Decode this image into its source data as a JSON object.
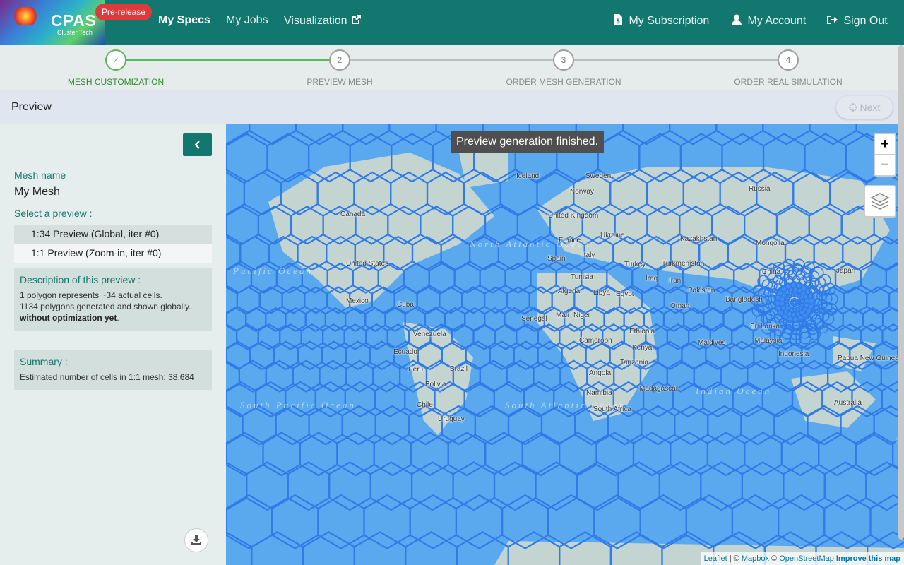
{
  "navbar": {
    "logo_text": "CPAS",
    "logo_subtext": "Cluster Tech",
    "badge": "Pre-release",
    "links": [
      {
        "label": "My Specs",
        "active": true
      },
      {
        "label": "My Jobs",
        "active": false
      },
      {
        "label": "Visualization",
        "icon": "external-link-icon"
      }
    ],
    "right_links": [
      {
        "label": "My Subscription",
        "icon": "dollar-file-icon"
      },
      {
        "label": "My Account",
        "icon": "user-icon"
      },
      {
        "label": "Sign Out",
        "icon": "sign-out-icon"
      }
    ]
  },
  "stepper": {
    "steps": [
      {
        "number": "✓",
        "label": "MESH CUSTOMIZATION",
        "done": true
      },
      {
        "number": "2",
        "label": "PREVIEW MESH",
        "done": false
      },
      {
        "number": "3",
        "label": "ORDER MESH GENERATION",
        "done": false
      },
      {
        "number": "4",
        "label": "ORDER REAL SIMULATION",
        "done": false
      }
    ]
  },
  "header": {
    "title": "Preview",
    "next_label": "Next"
  },
  "sidebar": {
    "mesh_name_label": "Mesh name",
    "mesh_name_value": "My Mesh",
    "select_label": "Select a preview :",
    "options": [
      {
        "label": "1:34 Preview (Global, iter #0)",
        "selected": true
      },
      {
        "label": "1:1 Preview (Zoom-in, iter #0)",
        "selected": false
      }
    ],
    "description": {
      "title": "Description of this preview :",
      "line1": "1 polygon represents ~34 actual cells.",
      "line2": "1134 polygons generated and shown globally.",
      "line3_bold": "without optimization yet",
      "line3_tail": "."
    },
    "summary": {
      "title": "Summary :",
      "line": "Estimated number of cells in 1:1 mesh: 38,684"
    }
  },
  "map": {
    "toast": "Preview generation finished.",
    "zoom_in": "+",
    "zoom_out": "−",
    "colors": {
      "water": "#5aa9ee",
      "cell_stroke": "#2f7be8",
      "land": "#cfd8cc"
    },
    "countries": [
      "Iceland",
      "Sweden",
      "Norway",
      "Russia",
      "Canada",
      "United Kingdom",
      "Ukraine",
      "Kazakhstan",
      "France",
      "Italy",
      "Mongolia",
      "United States",
      "Spain",
      "Turkey",
      "Turkmenistan",
      "China",
      "Tunisia",
      "Iraq",
      "Iran",
      "Japan",
      "Algeria",
      "Libya",
      "Egypt",
      "Pakistan",
      "Bangladesh",
      "Mexico",
      "Cuba",
      "Oman",
      "Mali",
      "Niger",
      "Senegal",
      "Ethiopia",
      "Venezuela",
      "Malaysia",
      "Maldives",
      "Cameroon",
      "Kenya",
      "Indonesia",
      "Ecuador",
      "Brazil",
      "Tanzania",
      "Papua New Guinea",
      "Peru",
      "Angola",
      "Bolivia",
      "Madagascar",
      "Namibia",
      "Australia",
      "Chile",
      "South Africa",
      "Uruguay",
      "Sri Lanka",
      "New"
    ],
    "oceans": [
      "North Atlantic Ocean",
      "South Pacific Ocean",
      "South Atlantic Ocean",
      "Indian Ocean",
      "Pacific Ocean"
    ],
    "attribution": {
      "leaflet": "Leaflet",
      "sep": " | © ",
      "mapbox": "Mapbox",
      "osm_prefix": " © ",
      "osm": "OpenStreetMap",
      "improve": "Improve this map"
    }
  }
}
